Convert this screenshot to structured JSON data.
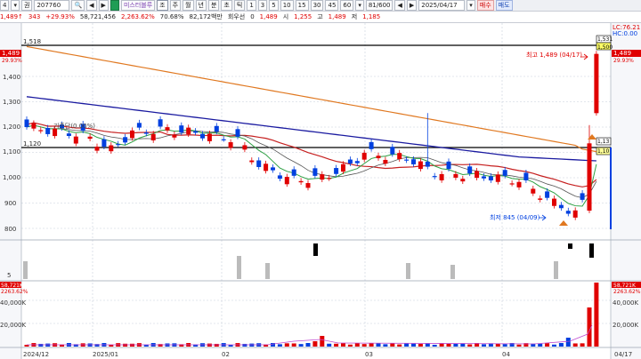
{
  "toolbar": {
    "market_btn": "4",
    "type_btn": "▾",
    "kind_btn": "권",
    "code": "207760",
    "search_btn": "🔍",
    "prev_btn": "◀",
    "next_btn": "▶",
    "stock_name": "미스터블루",
    "period_sel": "조",
    "periods": [
      "주",
      "월",
      "년",
      "분",
      "초",
      "틱"
    ],
    "minutes": [
      "1",
      "3",
      "5",
      "10",
      "15",
      "30",
      "45",
      "60"
    ],
    "minute_dropdown": "▾",
    "page_count": "81/600",
    "start_btn": "◀",
    "end_btn": "▶",
    "date": "2025/04/17",
    "cal_btn": "▾",
    "buy_btn": "매수",
    "sell_btn": "매도"
  },
  "quote": {
    "price": "1,489",
    "arrow": "↑",
    "change": "343",
    "change_pct": "+29.93%",
    "volume": "58,721,456",
    "volume_ratio": "2,263.62%",
    "turnover": "70.68%",
    "amount": "82,172백만",
    "preferred_label": "회우선",
    "preferred_value": "0",
    "current": "1,489",
    "open_label": "시",
    "open": "1,255",
    "high_label": "고",
    "high": "1,489",
    "low_label": "저",
    "low": "1,185"
  },
  "chart": {
    "ref_line_top": "1,518",
    "ref_line_mid": "1,120",
    "y_labels": [
      "1,400",
      "1,300",
      "1,200",
      "1,100",
      "1,000",
      "900",
      "800"
    ],
    "y_label_price": "1,489",
    "y_label_price_pct": "29.93%",
    "high_annotation": "최고 1,489 (04/17)",
    "low_annotation": "최저 845 (04/09)",
    "baseline_annotation": "기준단(0.00%)",
    "right_labels": {
      "lc": "LC:76.21",
      "hc": "HC:0.00",
      "r1": "1,531",
      "r2": "1,500",
      "r3": "1,489",
      "r4": "29.93%",
      "r5": "1,13",
      "r6": "1,10"
    },
    "subchart_label": "5",
    "volume_labels": [
      "40,000K",
      "20,000K"
    ],
    "volume_top": "58,721K",
    "volume_pct": "2263.62%",
    "volume_left_top": "58,721K",
    "volume_left_pct": "2263.62%",
    "volume_right_top": "58,721K",
    "volume_right_pct": "2263.62%",
    "volume_right_labels": [
      "40,000K",
      "20,000K"
    ],
    "x_labels": [
      "2024/12",
      "2025/01",
      "02",
      "03",
      "04",
      "04/17"
    ]
  },
  "colors": {
    "up": "#e00000",
    "down": "#0040e0",
    "ma5": "#2ea043",
    "ma20": "#c62020",
    "ma60": "#1a1aa0",
    "ma120": "#e07820"
  }
}
